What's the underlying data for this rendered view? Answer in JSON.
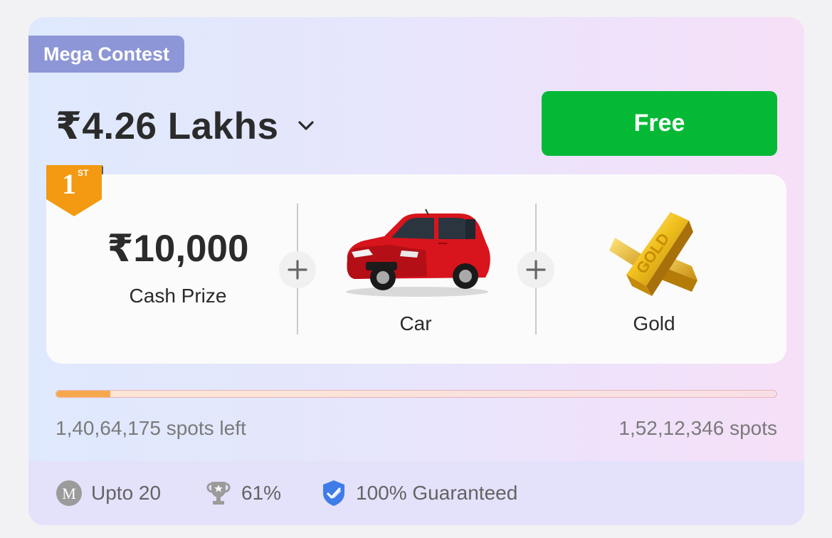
{
  "contest": {
    "tag": "Mega Contest",
    "prize_pool": "₹4.26 Lakhs",
    "entry_label": "Free"
  },
  "prizes": {
    "rank": "1",
    "rank_suffix": "ST",
    "cash_amount": "₹10,000",
    "cash_label": "Cash Prize",
    "items": [
      {
        "label": "Car",
        "icon": "car-icon"
      },
      {
        "label": "Gold",
        "icon": "gold-bars-icon"
      }
    ]
  },
  "spots": {
    "left": "1,40,64,175 spots left",
    "total": "1,52,12,346 spots",
    "filled_fraction": 0.075
  },
  "footer": {
    "max_entries": "Upto 20",
    "max_entries_icon": "m-circle-icon",
    "winners_percent": "61%",
    "winners_icon": "trophy-icon",
    "guarantee": "100% Guaranteed",
    "guarantee_icon": "verified-shield-icon"
  },
  "colors": {
    "free_button": "#05b936",
    "tag": "#8d96d6",
    "badge": "#f39a12",
    "progress_fill": "#f6a94c",
    "footer_bg": "#e4e1fb"
  }
}
